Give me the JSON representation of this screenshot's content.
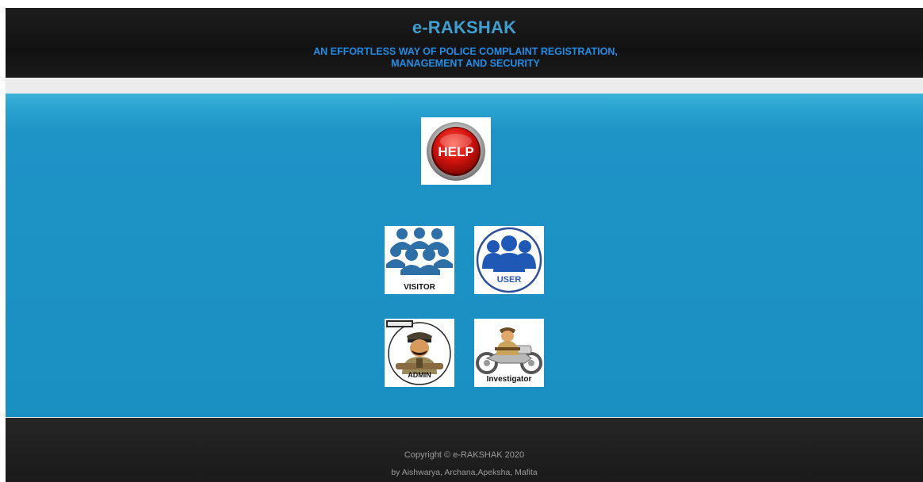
{
  "header": {
    "title": "e-RAKSHAK",
    "subtitle_line1": "AN EFFORTLESS WAY OF POLICE COMPLAINT REGISTRATION,",
    "subtitle_line2": "MANAGEMENT AND SECURITY"
  },
  "tiles": {
    "help": {
      "label": "HELP",
      "icon": "help-button-icon"
    },
    "visitor": {
      "label": "VISITOR",
      "icon": "visitor-group-icon"
    },
    "user": {
      "label": "USER",
      "icon": "user-group-icon"
    },
    "admin": {
      "label": "ADMIN",
      "icon": "police-officer-icon"
    },
    "investigator": {
      "label": "Investigator",
      "icon": "investigator-motorbike-icon"
    }
  },
  "footer": {
    "copyright": "Copyright © e-RAKSHAK 2020",
    "authors": "by Aishwarya, Archana,Apeksha, Mafita"
  },
  "colors": {
    "header_bg": "#151515",
    "title": "#3f9fd0",
    "subtitle": "#1f8ee8",
    "main_bg": "#1a8fc1",
    "footer_bg": "#1e1e1e",
    "footer_text": "#9a9a9a"
  }
}
